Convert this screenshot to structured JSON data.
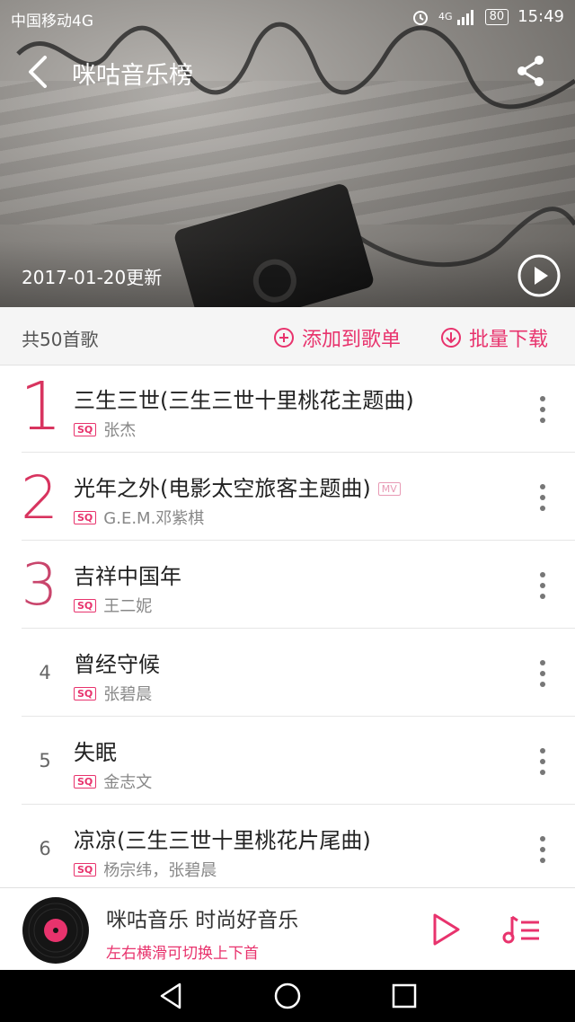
{
  "status_bar": {
    "carrier": "中国移动4G",
    "battery": "80",
    "time": "15:49",
    "network": "4G"
  },
  "header": {
    "title": "咪咕音乐榜",
    "updated": "2017-01-20更新"
  },
  "toolbar": {
    "count": "共50首歌",
    "add_to_playlist": "添加到歌单",
    "batch_download": "批量下载"
  },
  "badges": {
    "sq": "SQ",
    "mv": "MV"
  },
  "songs": [
    {
      "rank": "1",
      "title": "三生三世(三生三世十里桃花主题曲)",
      "artist": "张杰",
      "mv": false
    },
    {
      "rank": "2",
      "title": "光年之外(电影太空旅客主题曲)",
      "artist": "G.E.M.邓紫棋",
      "mv": true
    },
    {
      "rank": "3",
      "title": "吉祥中国年",
      "artist": "王二妮",
      "mv": false
    },
    {
      "rank": "4",
      "title": "曾经守候",
      "artist": "张碧晨",
      "mv": false
    },
    {
      "rank": "5",
      "title": "失眠",
      "artist": "金志文",
      "mv": false
    },
    {
      "rank": "6",
      "title": "凉凉(三生三世十里桃花片尾曲)",
      "artist": "杨宗纬，张碧晨",
      "mv": false
    }
  ],
  "player": {
    "line1": "咪咕音乐 时尚好音乐",
    "line2": "左右横滑可切换上下首"
  },
  "colors": {
    "accent": "#e8336d",
    "rank_top": "#d8345f"
  },
  "icons": [
    "back-arrow-icon",
    "share-icon",
    "play-circle-icon",
    "add-circle-icon",
    "download-icon",
    "more-vertical-icon",
    "vinyl-disc-icon",
    "play-icon",
    "playlist-icon",
    "nav-back-icon",
    "nav-home-icon",
    "nav-recents-icon"
  ]
}
